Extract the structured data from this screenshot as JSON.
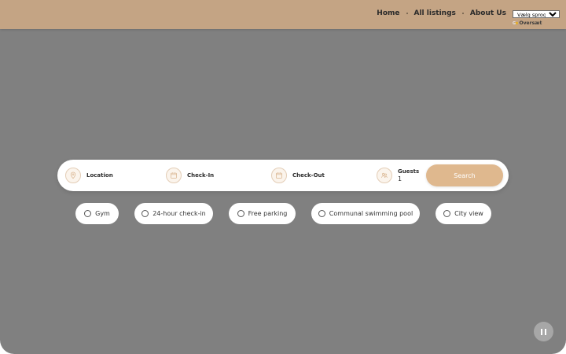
{
  "header": {
    "nav": [
      {
        "label": "Home"
      },
      {
        "label": "All listings"
      },
      {
        "label": "About Us"
      }
    ],
    "language_select": {
      "selected": "Vælg sprog",
      "options": [
        "Vælg sprog"
      ]
    },
    "translate_label": "Oversæt"
  },
  "search": {
    "location_label": "Location",
    "checkin_label": "Check-In",
    "checkout_label": "Check-Out",
    "guests_label": "Guests",
    "guests_value": "1",
    "button_label": "Search"
  },
  "filters": [
    {
      "label": "Gym"
    },
    {
      "label": "24-hour check-in"
    },
    {
      "label": "Free parking"
    },
    {
      "label": "Communal swimming pool"
    },
    {
      "label": "City view"
    }
  ],
  "colors": {
    "header_bg": "#c4a484",
    "hero_bg": "#808080",
    "accent": "#dfb88e"
  },
  "icons": {
    "location": "map-pin-icon",
    "checkin": "calendar-icon",
    "checkout": "calendar-icon",
    "guests": "guests-icon",
    "pause": "pause-icon"
  }
}
